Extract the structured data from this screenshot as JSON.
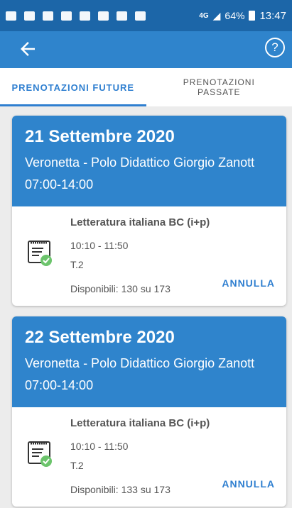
{
  "status": {
    "network": "4G",
    "battery": "64%",
    "time": "13:47"
  },
  "appbar": {
    "help_symbol": "?"
  },
  "tabs": [
    {
      "label": "PRENOTAZIONI FUTURE"
    },
    {
      "label": "PRENOTAZIONI PASSATE"
    }
  ],
  "colors": {
    "primary": "#2f84cc",
    "status_bar": "#1c66a8",
    "check": "#6cc46c"
  },
  "bookings": [
    {
      "date": "21 Settembre 2020",
      "place": "Veronetta - Polo Didattico Giorgio Zanott",
      "hours": "07:00-14:00",
      "course": "Letteratura italiana BC (i+p)",
      "time": "10:10 - 11:50",
      "room": "T.2",
      "available": "Disponibili: 130 su 173",
      "action": "ANNULLA"
    },
    {
      "date": "22 Settembre 2020",
      "place": "Veronetta - Polo Didattico Giorgio Zanott",
      "hours": "07:00-14:00",
      "course": "Letteratura italiana BC (i+p)",
      "time": "10:10 - 11:50",
      "room": "T.2",
      "available": "Disponibili: 133 su 173",
      "action": "ANNULLA"
    }
  ]
}
